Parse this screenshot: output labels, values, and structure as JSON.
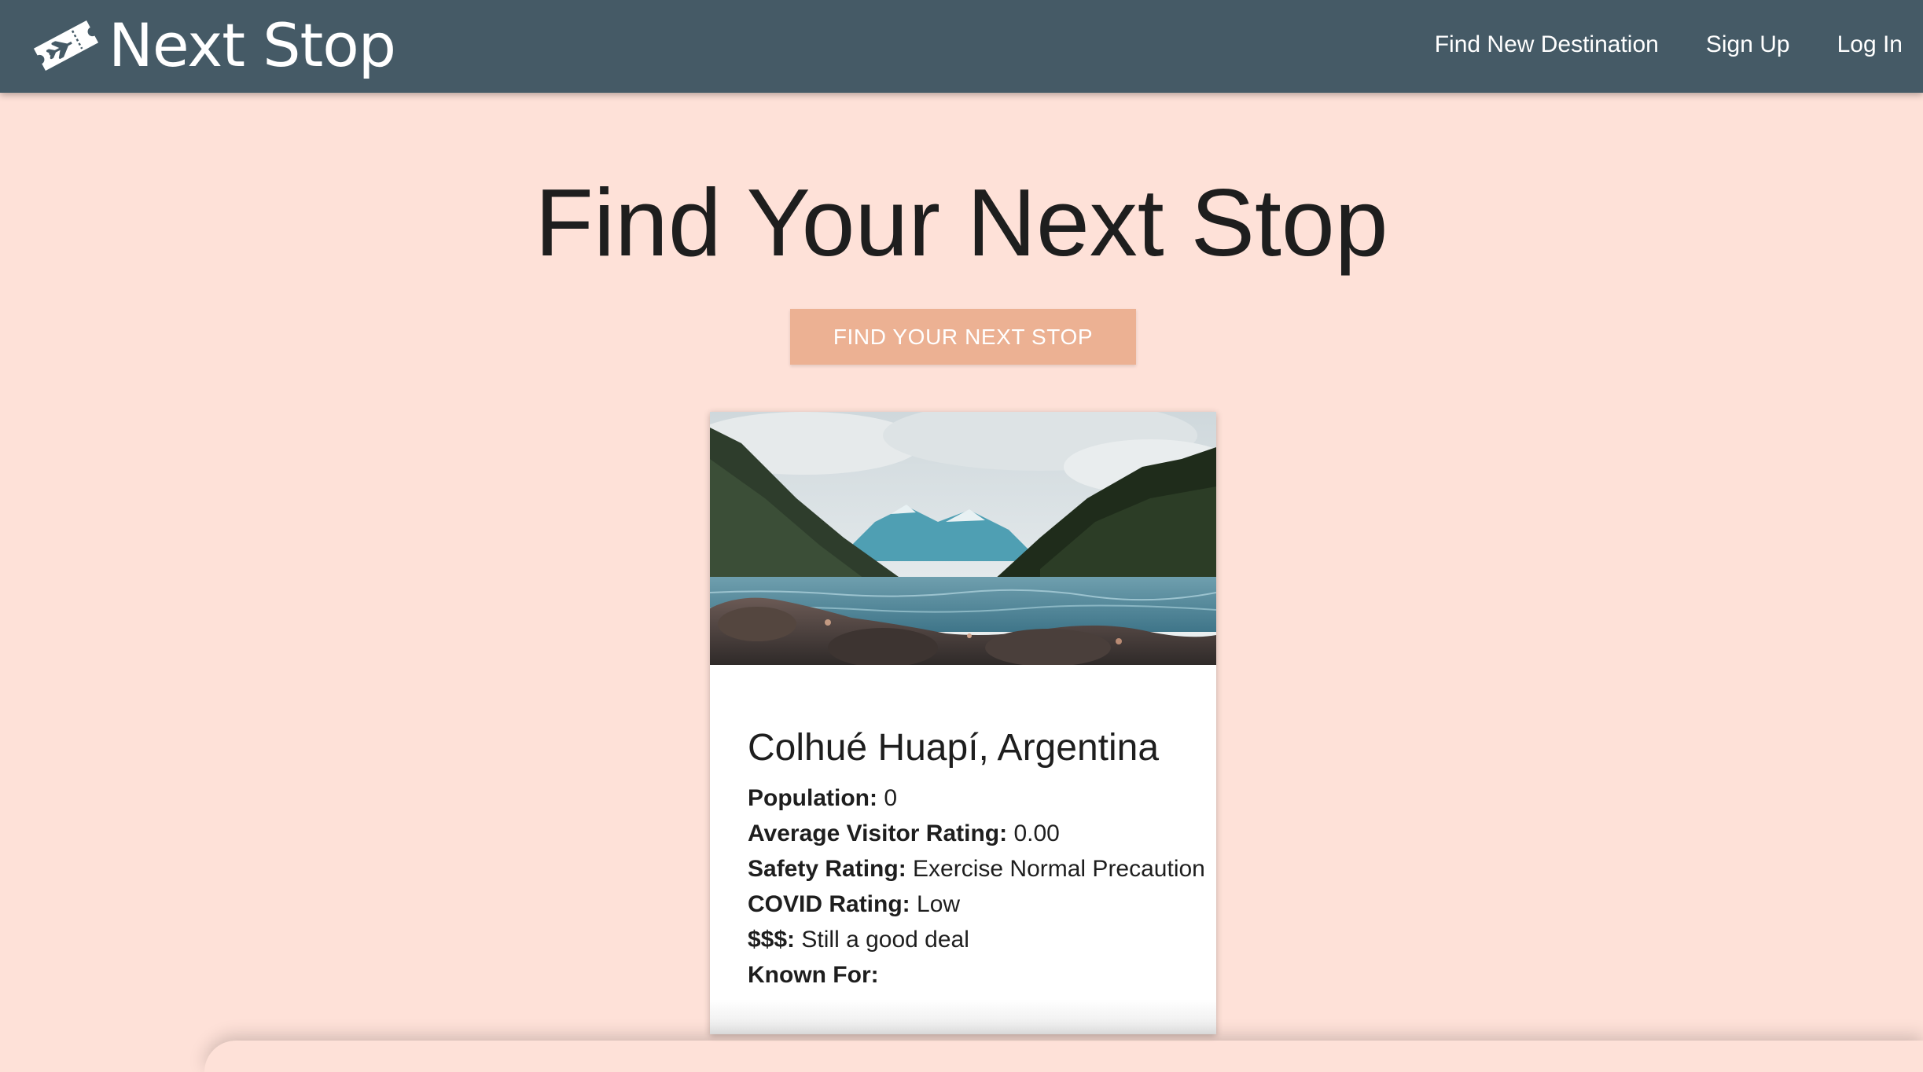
{
  "navbar": {
    "brand_icon": "plane-ticket-icon",
    "brand_name": "Next Stop",
    "links": [
      {
        "label": "Find New Destination"
      },
      {
        "label": "Sign Up"
      },
      {
        "label": "Log In"
      }
    ]
  },
  "hero": {
    "title": "Find Your Next Stop",
    "button_label": "FIND YOUR NEXT STOP"
  },
  "destination_card": {
    "image": "lake-mountains-photo",
    "title": "Colhué Huapí, Argentina",
    "details": [
      {
        "label": "Population:",
        "value": "0"
      },
      {
        "label": "Average Visitor Rating:",
        "value": "0.00"
      },
      {
        "label": "Safety Rating:",
        "value": "Exercise Normal Precaution"
      },
      {
        "label": "COVID Rating:",
        "value": "Low"
      },
      {
        "label": "$$$:",
        "value": "Still a good deal"
      },
      {
        "label": "Known For:",
        "value": ""
      }
    ]
  },
  "colors": {
    "navbar_bg": "#455a66",
    "page_bg": "#fee1d8",
    "button_bg": "#ecb193",
    "card_bg": "#ffffff",
    "text_dark": "#1e1e1e"
  }
}
